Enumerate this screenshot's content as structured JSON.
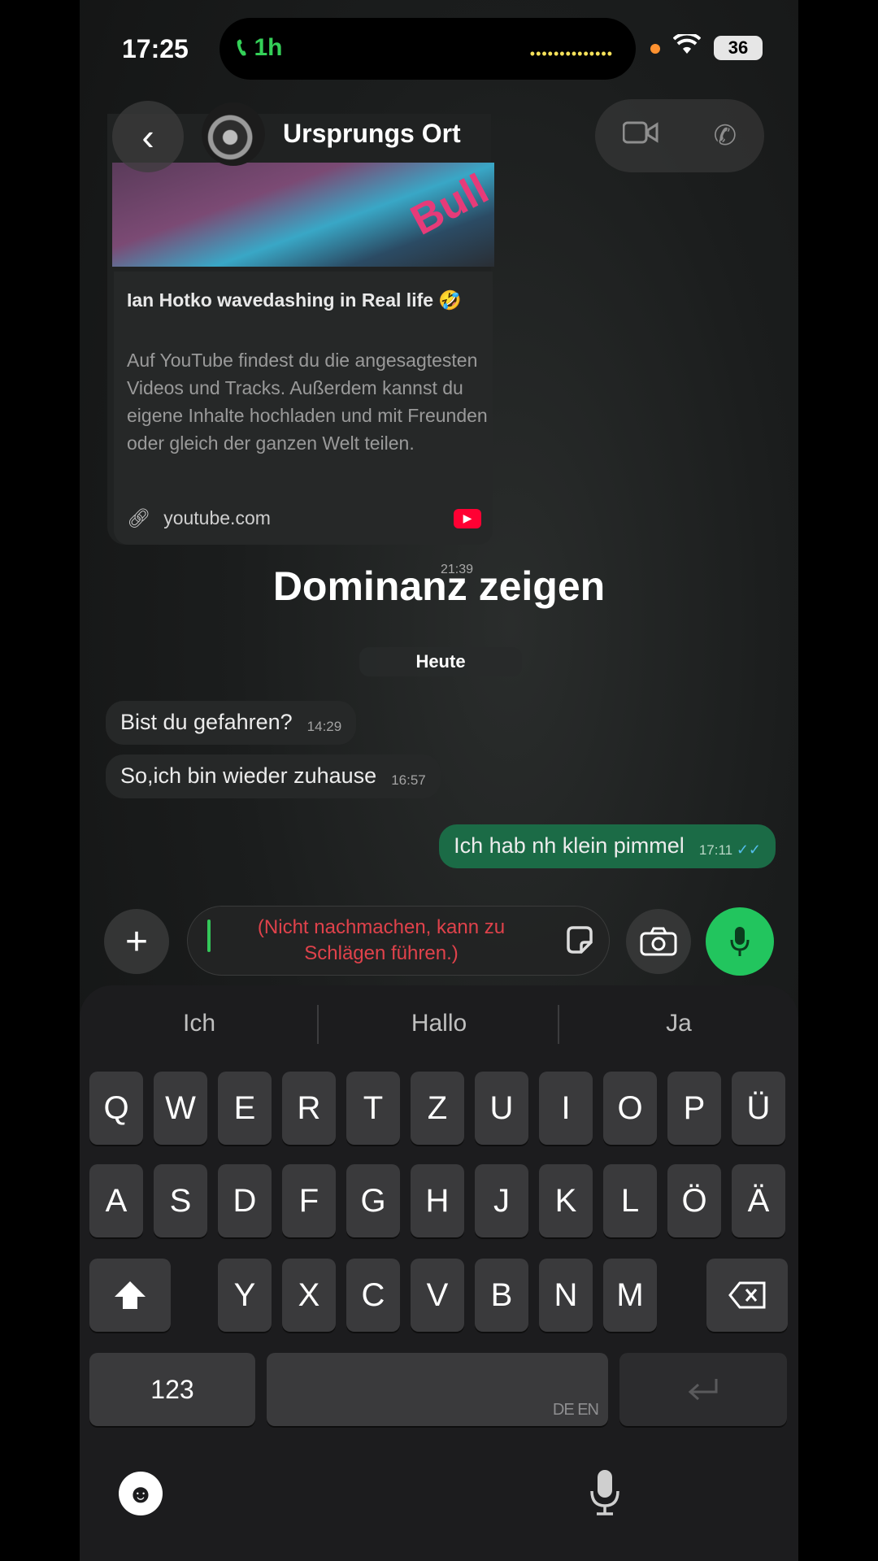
{
  "status_bar": {
    "time": "17:25",
    "call_duration": "1h",
    "battery": "36"
  },
  "header": {
    "chat_name": "Ursprungs Ort"
  },
  "link_preview": {
    "title": "Ian Hotko wavedashing in Real life 🤣",
    "description": "Auf YouTube findest du die angesagtesten Videos und Tracks. Außerdem kannst du eigene Inhalte hochladen und mit Freunden oder gleich der ganzen Welt teilen.",
    "url": "youtube.com",
    "time": "21:39",
    "thumbnail_text": "Bull"
  },
  "overlay_caption": "Dominanz zeigen",
  "date_divider": "Heute",
  "messages": [
    {
      "text": "Bist du gefahren?",
      "time": "14:29",
      "direction": "incoming"
    },
    {
      "text": "So,ich bin wieder zuhause",
      "time": "16:57",
      "direction": "incoming"
    },
    {
      "text": "Ich hab nh klein pimmel",
      "time": "17:11",
      "direction": "outgoing",
      "status": "read"
    }
  ],
  "composer": {
    "text": "(Nicht nachmachen, kann zu Schlägen führen.)"
  },
  "keyboard": {
    "suggestions": [
      "Ich",
      "Hallo",
      "Ja"
    ],
    "row1": [
      "Q",
      "W",
      "E",
      "R",
      "T",
      "Z",
      "U",
      "I",
      "O",
      "P",
      "Ü"
    ],
    "row2": [
      "A",
      "S",
      "D",
      "F",
      "G",
      "H",
      "J",
      "K",
      "L",
      "Ö",
      "Ä"
    ],
    "row3": [
      "Y",
      "X",
      "C",
      "V",
      "B",
      "N",
      "M"
    ],
    "numbers_label": "123",
    "languages_label": "DE EN"
  },
  "colors": {
    "accent_green": "#22c55e",
    "outgoing_bubble": "#1b6b46",
    "typed_text": "#e0424b"
  },
  "icons": [
    "phone-icon",
    "wifi-icon",
    "back-icon",
    "video-icon",
    "call-icon",
    "link-icon",
    "youtube-icon",
    "plus-icon",
    "sticker-icon",
    "camera-icon",
    "mic-icon",
    "shift-icon",
    "backspace-icon",
    "return-icon",
    "emoji-icon",
    "dictation-icon"
  ]
}
